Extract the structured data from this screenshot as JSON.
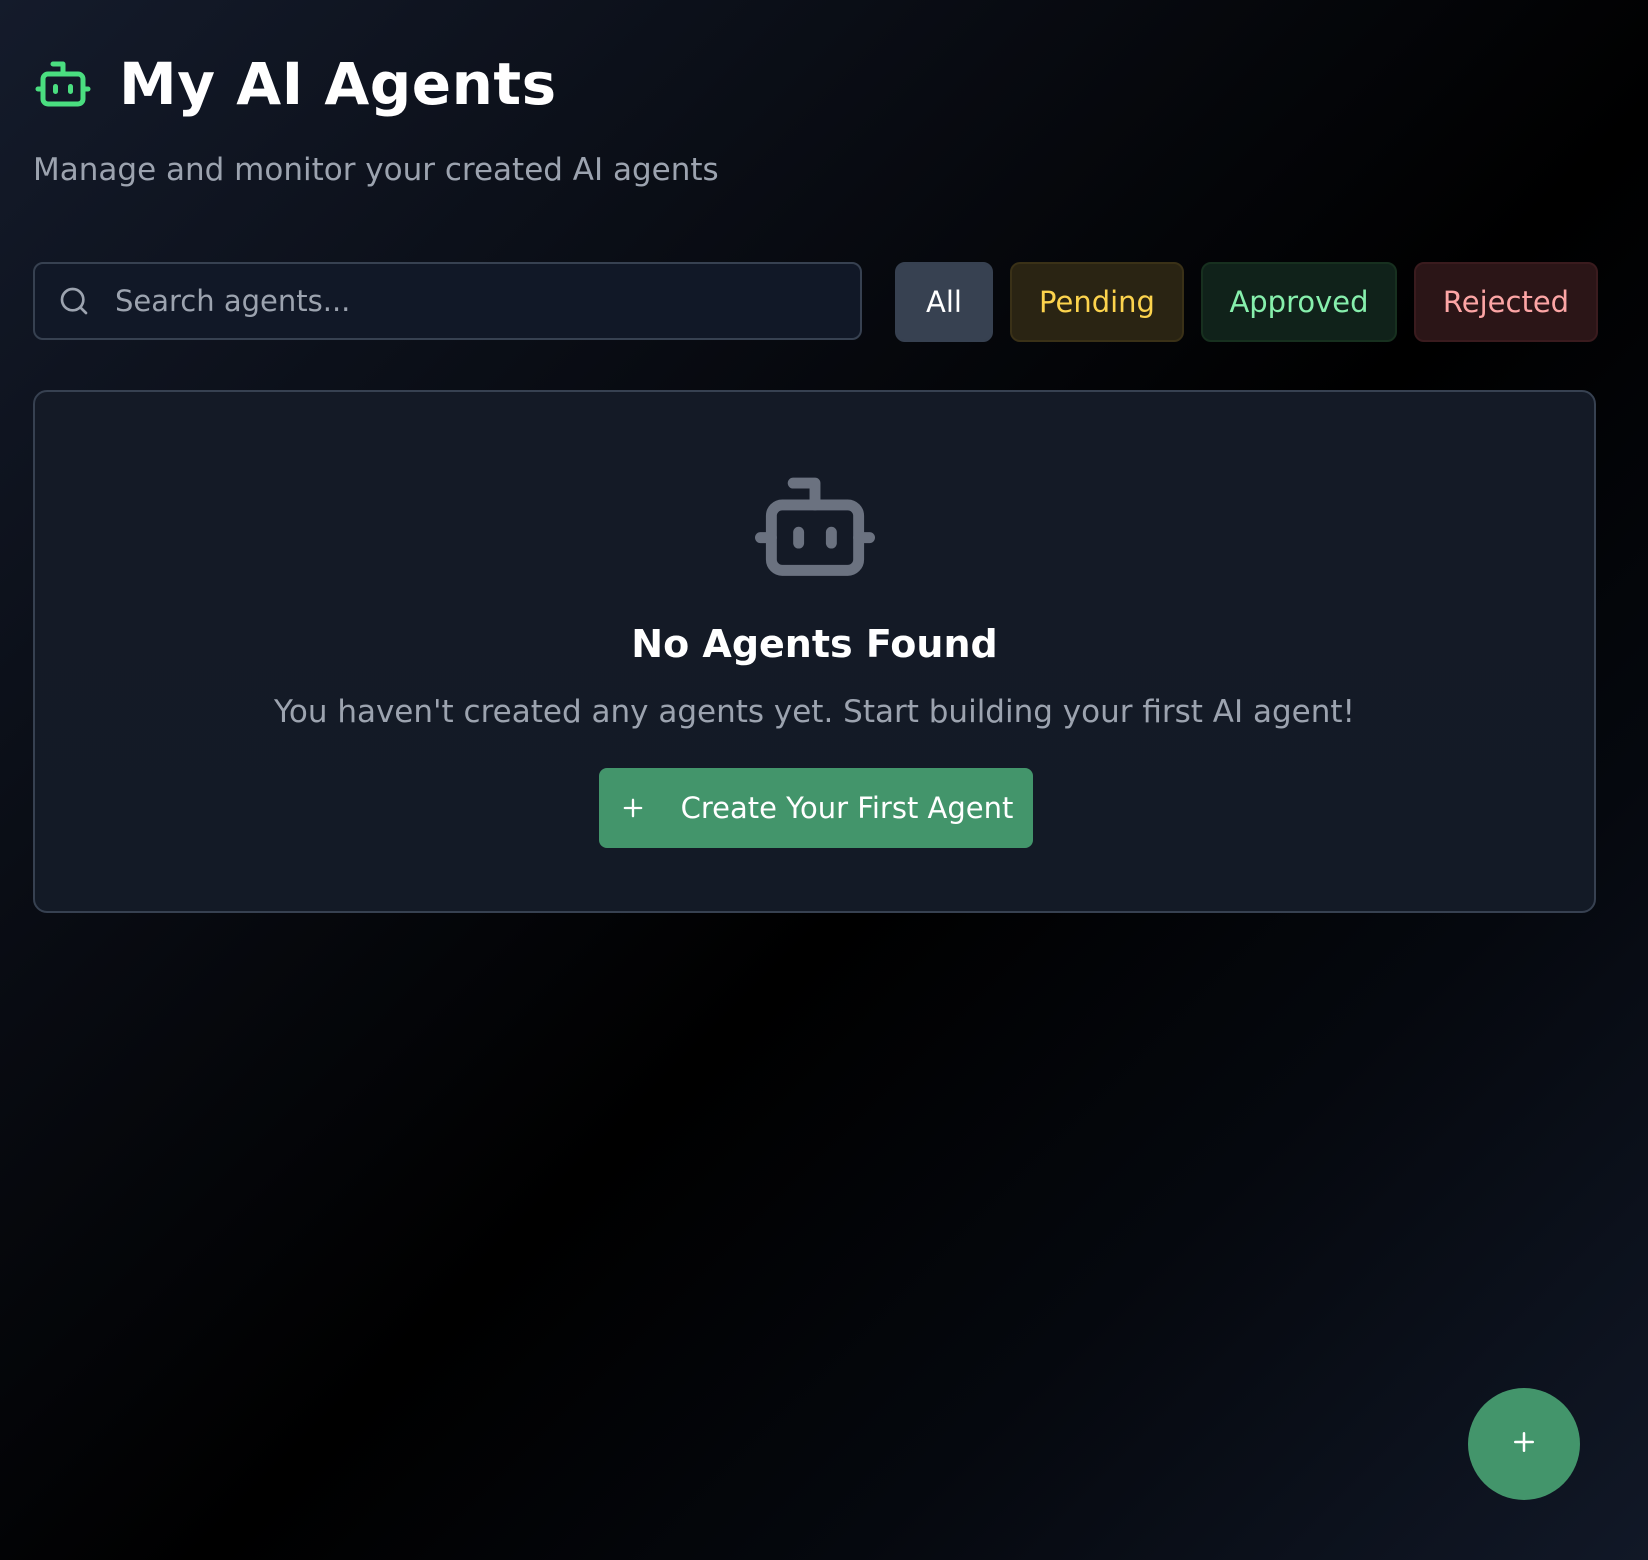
{
  "header": {
    "title": "My AI Agents",
    "subtitle": "Manage and monitor your created AI agents",
    "icon": "robot-icon",
    "icon_color": "#4ade80"
  },
  "search": {
    "placeholder": "Search agents...",
    "value": ""
  },
  "filters": [
    {
      "label": "All",
      "active": true,
      "color": "#ffffff"
    },
    {
      "label": "Pending",
      "active": false,
      "color": "#fcd34d"
    },
    {
      "label": "Approved",
      "active": false,
      "color": "#86efac"
    },
    {
      "label": "Rejected",
      "active": false,
      "color": "#fca5a5"
    }
  ],
  "empty_state": {
    "icon": "robot-icon",
    "title": "No Agents Found",
    "description": "You haven't created any agents yet. Start building your first AI agent!",
    "cta_label": "Create Your First Agent",
    "cta_icon": "plus-icon"
  },
  "fab": {
    "icon": "plus-icon"
  },
  "colors": {
    "accent": "#43956b",
    "muted_text": "#9ca3af",
    "border": "#374151"
  }
}
